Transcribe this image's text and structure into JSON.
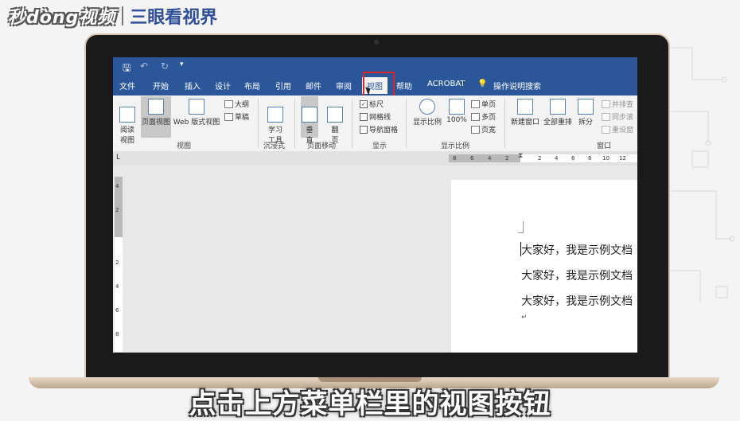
{
  "brand": {
    "logo": "秒dòng视频",
    "name": "三眼看视界"
  },
  "word": {
    "tabs": [
      "文件",
      "开始",
      "插入",
      "设计",
      "布局",
      "引用",
      "邮件",
      "审阅",
      "视图",
      "帮助",
      "ACROBAT",
      "操作说明搜索"
    ],
    "ribbon": {
      "read_view": "阅读\n视图",
      "page_view": "页面视图",
      "web_view": "Web 版式视图",
      "outline": "大纲",
      "draft": "草稿",
      "group_view": "视图",
      "learning_tools": "学习\n工具",
      "group_immersive": "沉浸式",
      "vertical": "垂\n直",
      "flip": "翻\n页",
      "group_page_move": "页面移动",
      "ruler": "标尺",
      "gridlines": "网格线",
      "nav_pane": "导航窗格",
      "group_show": "显示",
      "zoom": "显示比例",
      "zoom100": "100%",
      "one_page": "单页",
      "multi_page": "多页",
      "page_width": "页宽",
      "group_zoom": "显示比例",
      "new_window": "新建窗口",
      "arrange_all": "全部重排",
      "split": "拆分",
      "side_by_side": "并排查",
      "sync_scroll": "同步滚",
      "reset_pos": "重设窗",
      "group_window": "窗口"
    },
    "ruler_h": [
      "8",
      "6",
      "4",
      "2",
      "2",
      "4",
      "6",
      "8",
      "10",
      "12"
    ],
    "ruler_v": [
      "4",
      "2",
      "2",
      "4",
      "6",
      "8"
    ],
    "corner": "L",
    "doc_lines": [
      "大家好，我是示例文档",
      "大家好，我是示例文档",
      "大家好，我是示例文档"
    ],
    "para_mark": "↵"
  },
  "caption": "点击上方菜单栏里的视图按钮",
  "colors": {
    "word_blue": "#2b579a",
    "highlight_red": "#d8262b"
  }
}
